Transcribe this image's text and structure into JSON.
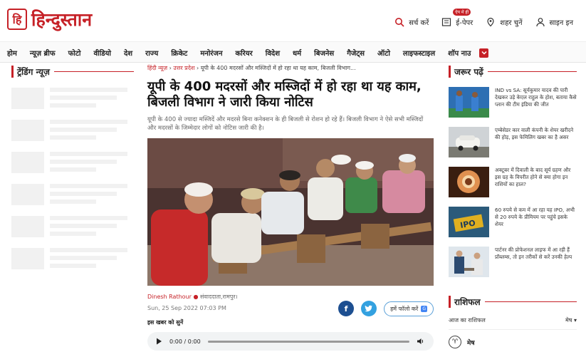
{
  "header": {
    "logo_mark": "हि",
    "logo_text": "हिन्दुस्तान",
    "search_label": "सर्च करें",
    "epaper_label": "ई-पेपर",
    "epaper_badge": "ऐप में ही",
    "city_label": "शहर चुनें",
    "signin_label": "साइन इन"
  },
  "nav": {
    "items": [
      "होम",
      "न्यूज़ ब्रीफ",
      "फोटो",
      "वीडियो",
      "देश",
      "राज्य",
      "क्रिकेट",
      "मनोरंजन",
      "करियर",
      "विदेश",
      "धर्म",
      "बिजनेस",
      "गैजेट्स",
      "ऑटो",
      "लाइफस्टाइल",
      "शॉप नाउ"
    ],
    "more_icon": "chevron-down-icon"
  },
  "left": {
    "section_title": "ट्रेंडिंग न्यूज़"
  },
  "article": {
    "breadcrumb": [
      "हिंदी न्यूज़",
      "उत्तर प्रदेश",
      "यूपी के 400 मदरसों और मस्जिदों में हो रहा था यह काम, बिजली विभाग..."
    ],
    "headline": "यूपी के 400 मदरसों और मस्जिदों में हो रहा था यह काम, बिजली विभाग ने जारी किया नोटिस",
    "summary": "यूपी के 400 से ज्यादा मस्जिदें और मदरसे बिना कनेक्शन के ही बिजली से रोशन हो रहे हैं। बिजली विभाग ने ऐसे सभी मस्जिदों और मदरसों के जिम्मेदार लोगों को नोटिस जारी की है।",
    "author": "Dinesh Rathour",
    "author_sub": "संवाददाता,रामपुर।",
    "date": "Sun, 25 Sep 2022 07:03 PM",
    "follow_label": "हमें फॉलो करें",
    "follow_badge": "G",
    "listen_label": "इस खबर को सुनें",
    "player_time": "0:00 / 0:00"
  },
  "right": {
    "section_title": "जरूर पढ़ें",
    "news": [
      {
        "text": "IND vs SA: सूर्यकुमार यादव की पारी देखकर उड़े केएल राहुल के होश, बताया कैसे प्लान की टीम इंडिया की जीत"
      },
      {
        "text": "एम्बेसेडर कार वाली कंपनी के शेयर खरीदने की होड़, इस फेमिलिग खबर का है असर"
      },
      {
        "text": "अक्टूबर में दिवाली के बाद सूर्य ग्रहण और इस ग्रह के विपरीत होने से क्या होगा इन राशियों का हाल?"
      },
      {
        "text": "60 रुपये से कम में आ रहा यह IPO, अभी से 20 रुपये के प्रीमियम पर पहुंचे इसके शेयर"
      },
      {
        "text": "पार्टनर की प्रोफेशनल लाइफ में आ रही हैं प्रॉब्लम्स, तो इन तरीकों से करें उनकी हेल्प"
      }
    ],
    "rashi_title": "राशिफल",
    "rashi_today": "आज का राशिफल",
    "rashi_select": "मेष",
    "rashi_sign": "मेष",
    "ipo_label": "IPO"
  },
  "colors": {
    "brand": "#c62127"
  }
}
